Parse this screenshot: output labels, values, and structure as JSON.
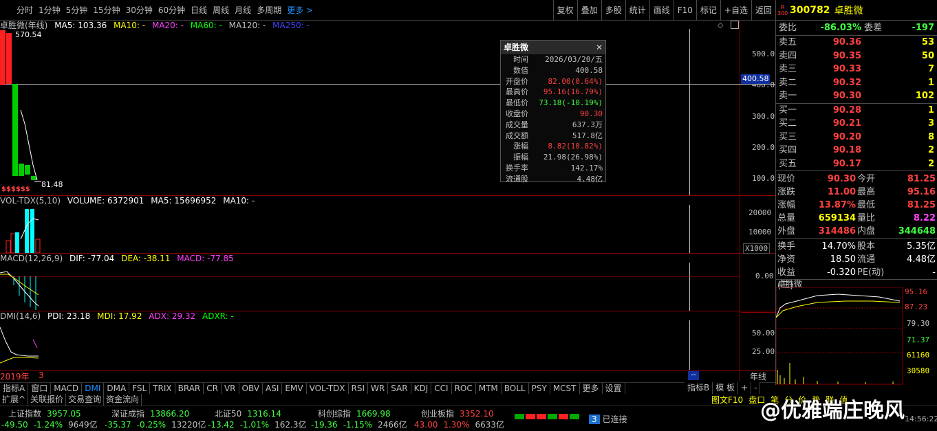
{
  "toolbar": {
    "left": [
      "分时",
      "1分钟",
      "5分钟",
      "15分钟",
      "30分钟",
      "60分钟",
      "日线",
      "周线",
      "月线",
      "多周期"
    ],
    "more": "更多 >",
    "right": [
      "复权",
      "叠加",
      "多股",
      "统计",
      "画线",
      "F10",
      "标记",
      "+自选",
      "返回"
    ]
  },
  "main_header": {
    "title": "卓胜微(年线)",
    "ma5": "MA5: 103.36",
    "ma10": "MA10: -",
    "ma20": "MA20: -",
    "ma60": "MA60: -",
    "ma120": "MA120: -",
    "ma250": "MA250: -"
  },
  "price_labels": {
    "high": "570.54",
    "low": "81.48",
    "cursor": "400.58",
    "ss": "$$$$$$"
  },
  "price_axis": [
    "500.0",
    "400.0",
    "300.0",
    "200.0",
    "100.0"
  ],
  "vol_header": {
    "name": "VOL-TDX(5,10)",
    "volume": "VOLUME: 6372901",
    "ma5": "MA5: 15696952",
    "ma10": "MA10: -"
  },
  "vol_axis": [
    "20000",
    "10000"
  ],
  "vol_unit": "X1000",
  "macd_header": {
    "name": "MACD(12,26,9)",
    "dif": "DIF: -77.04",
    "dea": "DEA: -38.11",
    "macd": "MACD: -77.85"
  },
  "macd_axis": [
    "0.00"
  ],
  "dmi_header": {
    "name": "DMI(14,6)",
    "pdi": "PDI: 23.18",
    "mdi": "MDI: 17.92",
    "adx": "ADX: 29.32",
    "adxr": "ADXR: -"
  },
  "dmi_axis": [
    "50.00",
    "25.00"
  ],
  "date_labels": {
    "year": "2019年",
    "num": "3",
    "period": "年线",
    "cursor_date": "--"
  },
  "tooltip": {
    "title": "卓胜微",
    "close_x": "✕",
    "rows": [
      {
        "k": "时间",
        "v": "2026/03/20/五",
        "c": "#c0c0c0"
      },
      {
        "k": "数值",
        "v": "400.58",
        "c": "#c0c0c0"
      },
      {
        "k": "开盘价",
        "v": "82.00(0.64%)",
        "c": "#ff4040"
      },
      {
        "k": "最高价",
        "v": "95.16(16.79%)",
        "c": "#ff4040"
      },
      {
        "k": "最低价",
        "v": "73.18(-10.19%)",
        "c": "#40ff40"
      },
      {
        "k": "收盘价",
        "v": "90.30",
        "c": "#ff4040"
      },
      {
        "k": "成交量",
        "v": "637.3万",
        "c": "#c0c0c0"
      },
      {
        "k": "成交额",
        "v": "517.8亿",
        "c": "#c0c0c0"
      },
      {
        "k": "涨幅",
        "v": "8.82(10.82%)",
        "c": "#ff4040"
      },
      {
        "k": "振幅",
        "v": "21.98(26.98%)",
        "c": "#c0c0c0"
      },
      {
        "k": "换手率",
        "v": "142.17%",
        "c": "#c0c0c0"
      },
      {
        "k": "流通股",
        "v": "4.48亿",
        "c": "#c0c0c0"
      }
    ]
  },
  "side": {
    "badge_r": "R",
    "badge_300": "300",
    "code": "300782",
    "name": "卓胜微",
    "weibi": {
      "l": "委比",
      "v": "-86.03%",
      "l2": "委差",
      "v2": "-197"
    },
    "asks": [
      {
        "l": "卖五",
        "p": "90.36",
        "q": "53"
      },
      {
        "l": "卖四",
        "p": "90.35",
        "q": "50"
      },
      {
        "l": "卖三",
        "p": "90.33",
        "q": "7"
      },
      {
        "l": "卖二",
        "p": "90.32",
        "q": "1"
      },
      {
        "l": "卖一",
        "p": "90.30",
        "q": "102"
      }
    ],
    "bids": [
      {
        "l": "买一",
        "p": "90.28",
        "q": "1"
      },
      {
        "l": "买二",
        "p": "90.21",
        "q": "3"
      },
      {
        "l": "买三",
        "p": "90.20",
        "q": "8"
      },
      {
        "l": "买四",
        "p": "90.18",
        "q": "2"
      },
      {
        "l": "买五",
        "p": "90.17",
        "q": "2"
      }
    ],
    "quote": [
      {
        "a": "现价",
        "b": "90.30",
        "bc": "#ff4040",
        "c": "今开",
        "d": "81.25",
        "dc": "#ff4040"
      },
      {
        "a": "涨跌",
        "b": "11.00",
        "bc": "#ff4040",
        "c": "最高",
        "d": "95.16",
        "dc": "#ff4040"
      },
      {
        "a": "涨幅",
        "b": "13.87%",
        "bc": "#ff4040",
        "c": "最低",
        "d": "81.25",
        "dc": "#ff4040"
      },
      {
        "a": "总量",
        "b": "659134",
        "bc": "#ffff00",
        "c": "量比",
        "d": "8.22",
        "dc": "#ff40ff"
      },
      {
        "a": "外盘",
        "b": "314486",
        "bc": "#ff4040",
        "c": "内盘",
        "d": "344648",
        "dc": "#40ff40"
      }
    ],
    "quote2": [
      {
        "a": "换手",
        "b": "14.70%",
        "c": "股本",
        "d": "5.35亿"
      },
      {
        "a": "净资",
        "b": "18.50",
        "c": "流通",
        "d": "4.48亿"
      },
      {
        "a": "收益(三)",
        "b": "-0.320",
        "c": "PE(动)",
        "d": "-"
      }
    ],
    "mini_title": "卓胜微",
    "mini_axis": [
      "95.16",
      "87.23",
      "79.30",
      "71.37",
      "61160",
      "30580"
    ]
  },
  "tabs": [
    "指标A",
    "窗口",
    "MACD",
    "DMI",
    "DMA",
    "FSL",
    "TRIX",
    "BRAR",
    "CR",
    "VR",
    "OBV",
    "ASI",
    "EMV",
    "VOL-TDX",
    "RSI",
    "WR",
    "SAR",
    "KDJ",
    "CCI",
    "ROC",
    "MTM",
    "BOLL",
    "PSY",
    "MCST",
    "更多",
    "设置"
  ],
  "tabs_right": [
    "指标B",
    "模 板",
    "+",
    "-"
  ],
  "tabs2": [
    "扩展^",
    "关联报价",
    "交易查询",
    "资金流向"
  ],
  "side_tabs": [
    "图文F10",
    "盘口",
    "笔",
    "分",
    "价",
    "势",
    "联",
    "值"
  ],
  "indices": [
    {
      "name": "上证指数",
      "val": "3957.05",
      "chg": "-49.50",
      "pct": "-1.24%",
      "amt": "9649亿"
    },
    {
      "name": "深证成指",
      "val": "13866.20",
      "chg": "-35.37",
      "pct": "-0.25%",
      "amt": "13220亿"
    },
    {
      "name": "北证50",
      "val": "1316.14",
      "chg": "-13.42",
      "pct": "-1.01%",
      "amt": "162.3亿"
    },
    {
      "name": "科创综指",
      "val": "1669.98",
      "chg": "-19.36",
      "pct": "-1.15%",
      "amt": "2466亿"
    },
    {
      "name": "创业板指",
      "val": "3352.10",
      "chg": "43.00",
      "pct": "1.30%",
      "amt": "6633亿"
    }
  ],
  "conn": {
    "num": "3",
    "text": "已连接"
  },
  "watermark": "@优雅端庄晚风",
  "time": "14:56:22"
}
